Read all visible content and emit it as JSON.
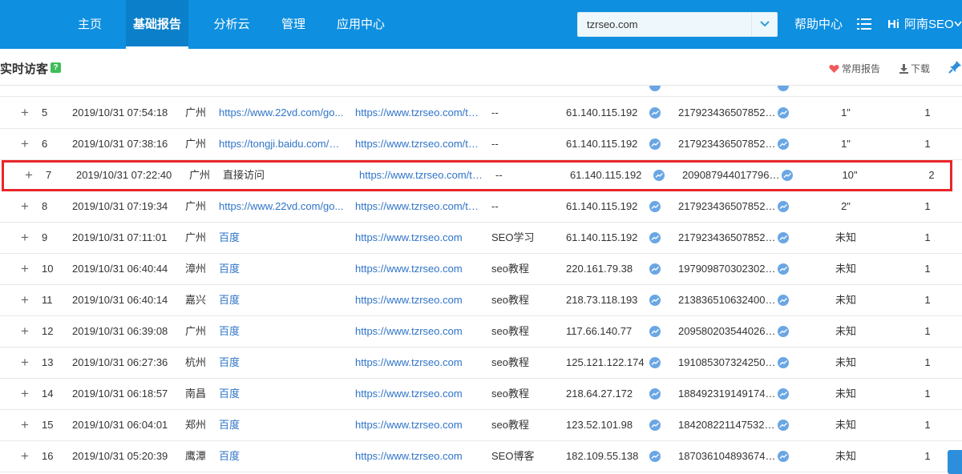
{
  "nav": {
    "items": [
      {
        "label": "主页",
        "active": false
      },
      {
        "label": "基础报告",
        "active": true
      },
      {
        "label": "分析云",
        "active": false
      },
      {
        "label": "管理",
        "active": false
      },
      {
        "label": "应用中心",
        "active": false
      }
    ],
    "site_value": "tzrseo.com",
    "help": "帮助中心",
    "user_hi": "Hi",
    "user_name": "阿南SEO"
  },
  "subheader": {
    "title": "实时访客",
    "help_mark": "?",
    "favorite_label": "常用报告",
    "download_label": "下载"
  },
  "colors": {
    "nav_bg": "#0e8fe0",
    "link": "#2f74c8",
    "highlight_border": "#e8262a",
    "help_badge": "#3fbd5a"
  },
  "rows": [
    {
      "expand": "+",
      "idx": "5",
      "time": "2019/10/31 07:54:18",
      "city": "广州",
      "source": "https://www.22vd.com/go...",
      "source_link": true,
      "entry": "https://www.tzrseo.com/to...",
      "keyword": "--",
      "ip": "61.140.115.192",
      "visitor_id": "2179234365078520...",
      "duration": "1\"",
      "pv": "1",
      "highlight": false
    },
    {
      "expand": "+",
      "idx": "6",
      "time": "2019/10/31 07:38:16",
      "city": "广州",
      "source": "https://tongji.baidu.com/w...",
      "source_link": true,
      "entry": "https://www.tzrseo.com/to...",
      "keyword": "--",
      "ip": "61.140.115.192",
      "visitor_id": "2179234365078520...",
      "duration": "1\"",
      "pv": "1",
      "highlight": false
    },
    {
      "expand": "+",
      "idx": "7",
      "time": "2019/10/31 07:22:40",
      "city": "广州",
      "source": "直接访问",
      "source_link": false,
      "entry": "https://www.tzrseo.com/to...",
      "keyword": "--",
      "ip": "61.140.115.192",
      "visitor_id": "2090879440177961...",
      "duration": "10\"",
      "pv": "2",
      "highlight": true
    },
    {
      "expand": "+",
      "idx": "8",
      "time": "2019/10/31 07:19:34",
      "city": "广州",
      "source": "https://www.22vd.com/go...",
      "source_link": true,
      "entry": "https://www.tzrseo.com/to...",
      "keyword": "--",
      "ip": "61.140.115.192",
      "visitor_id": "2179234365078520...",
      "duration": "2\"",
      "pv": "1",
      "highlight": false
    },
    {
      "expand": "+",
      "idx": "9",
      "time": "2019/10/31 07:11:01",
      "city": "广州",
      "source": "百度",
      "source_link": true,
      "entry": "https://www.tzrseo.com",
      "keyword": "SEO学习",
      "ip": "61.140.115.192",
      "visitor_id": "2179234365078520...",
      "duration": "未知",
      "pv": "1",
      "highlight": false
    },
    {
      "expand": "+",
      "idx": "10",
      "time": "2019/10/31 06:40:44",
      "city": "漳州",
      "source": "百度",
      "source_link": true,
      "entry": "https://www.tzrseo.com",
      "keyword": "seo教程",
      "ip": "220.161.79.38",
      "visitor_id": "1979098703023024...",
      "duration": "未知",
      "pv": "1",
      "highlight": false
    },
    {
      "expand": "+",
      "idx": "11",
      "time": "2019/10/31 06:40:14",
      "city": "嘉兴",
      "source": "百度",
      "source_link": true,
      "entry": "https://www.tzrseo.com",
      "keyword": "seo教程",
      "ip": "218.73.118.193",
      "visitor_id": "2138365106324003...",
      "duration": "未知",
      "pv": "1",
      "highlight": false
    },
    {
      "expand": "+",
      "idx": "12",
      "time": "2019/10/31 06:39:08",
      "city": "广州",
      "source": "百度",
      "source_link": true,
      "entry": "https://www.tzrseo.com",
      "keyword": "seo教程",
      "ip": "117.66.140.77",
      "visitor_id": "2095802035440261...",
      "duration": "未知",
      "pv": "1",
      "highlight": false
    },
    {
      "expand": "+",
      "idx": "13",
      "time": "2019/10/31 06:27:36",
      "city": "杭州",
      "source": "百度",
      "source_link": true,
      "entry": "https://www.tzrseo.com",
      "keyword": "seo教程",
      "ip": "125.121.122.174",
      "visitor_id": "1910853073242507...",
      "duration": "未知",
      "pv": "1",
      "highlight": false
    },
    {
      "expand": "+",
      "idx": "14",
      "time": "2019/10/31 06:18:57",
      "city": "南昌",
      "source": "百度",
      "source_link": true,
      "entry": "https://www.tzrseo.com",
      "keyword": "seo教程",
      "ip": "218.64.27.172",
      "visitor_id": "1884923191491742...",
      "duration": "未知",
      "pv": "1",
      "highlight": false
    },
    {
      "expand": "+",
      "idx": "15",
      "time": "2019/10/31 06:04:01",
      "city": "郑州",
      "source": "百度",
      "source_link": true,
      "entry": "https://www.tzrseo.com",
      "keyword": "seo教程",
      "ip": "123.52.101.98",
      "visitor_id": "1842082211475327...",
      "duration": "未知",
      "pv": "1",
      "highlight": false
    },
    {
      "expand": "+",
      "idx": "16",
      "time": "2019/10/31 05:20:39",
      "city": "鹰潭",
      "source": "百度",
      "source_link": true,
      "entry": "https://www.tzrseo.com",
      "keyword": "SEO博客",
      "ip": "182.109.55.138",
      "visitor_id": "1870361048936745...",
      "duration": "未知",
      "pv": "1",
      "highlight": false
    }
  ]
}
